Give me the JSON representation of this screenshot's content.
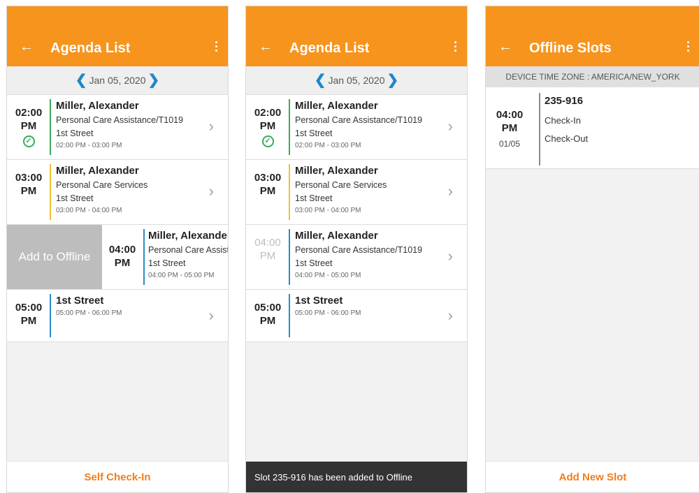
{
  "colors": {
    "header": "#f7941d",
    "accent": "#f07e1c",
    "nav_chevron": "#1e88c7",
    "green": "#3aaa5a",
    "yellow": "#f2c12e",
    "blue": "#2b8cc4"
  },
  "icons": {
    "back": "back-arrow-icon",
    "menu": "more-vert-icon",
    "prev": "chevron-left-icon",
    "next": "chevron-right-icon",
    "done": "check-circle-icon",
    "open": "chevron-right-icon"
  },
  "screen1": {
    "title": "Agenda List",
    "date": "Jan 05, 2020",
    "rows": [
      {
        "time": "02:00",
        "ampm": "PM",
        "name": "Miller, Alexander",
        "service": "Personal Care Assistance/T1019",
        "address": "1st Street",
        "span": "02:00 PM - 03:00 PM"
      },
      {
        "time": "03:00",
        "ampm": "PM",
        "name": "Miller, Alexander",
        "service": "Personal Care Services",
        "address": "1st Street",
        "span": "03:00 PM - 04:00 PM"
      },
      {
        "time": "04:00",
        "ampm": "PM",
        "name": "Miller, Alexander",
        "service": "Personal Care Assist",
        "address": "1st Street",
        "span": "04:00 PM - 05:00 PM",
        "swipe_action": "Add to Offline"
      },
      {
        "time": "05:00",
        "ampm": "PM",
        "address": "1st Street",
        "span": "05:00 PM - 06:00 PM"
      }
    ],
    "bottom_button": "Self Check-In"
  },
  "screen2": {
    "title": "Agenda List",
    "date": "Jan 05, 2020",
    "rows": [
      {
        "time": "02:00",
        "ampm": "PM",
        "name": "Miller, Alexander",
        "service": "Personal Care Assistance/T1019",
        "address": "1st Street",
        "span": "02:00 PM - 03:00 PM"
      },
      {
        "time": "03:00",
        "ampm": "PM",
        "name": "Miller, Alexander",
        "service": "Personal Care Services",
        "address": "1st Street",
        "span": "03:00 PM - 04:00 PM"
      },
      {
        "time": "04:00",
        "ampm": "PM",
        "name": "Miller, Alexander",
        "service": "Personal Care Assistance/T1019",
        "address": "1st Street",
        "span": "04:00 PM - 05:00 PM"
      },
      {
        "time": "05:00",
        "ampm": "PM",
        "address": "1st Street",
        "span": "05:00 PM - 06:00 PM"
      }
    ],
    "toast": "Slot 235-916 has been added to Offline"
  },
  "screen3": {
    "title": "Offline Slots",
    "timezone": "DEVICE TIME ZONE : AMERICA/NEW_YORK",
    "slot": {
      "time": "04:00",
      "ampm": "PM",
      "date": "01/05",
      "id": "235-916",
      "events": [
        "Check-In",
        "Check-Out"
      ]
    },
    "bottom_button": "Add New Slot"
  }
}
